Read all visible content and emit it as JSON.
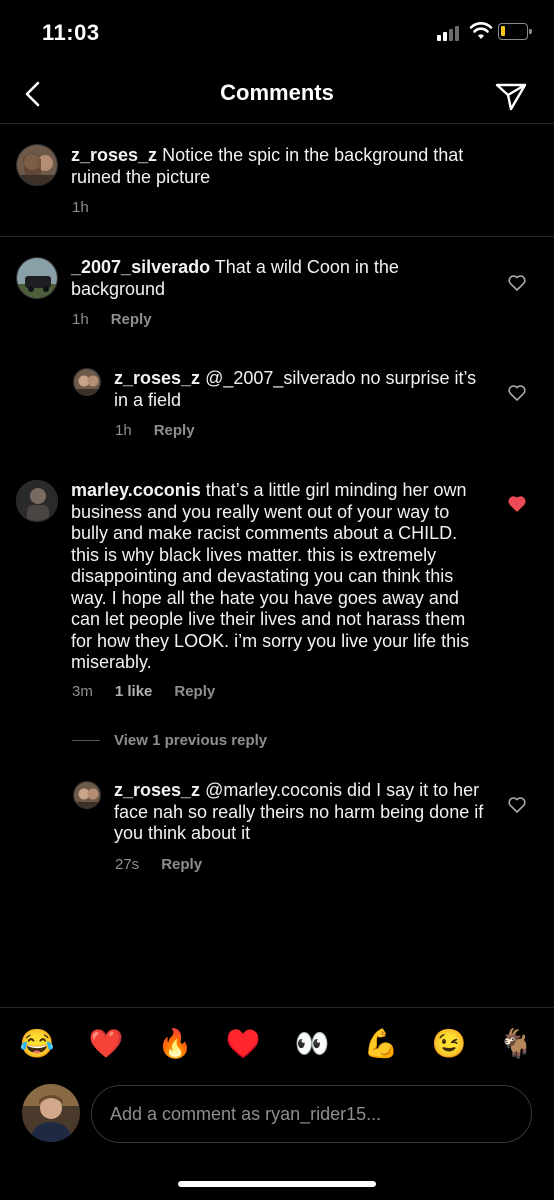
{
  "status_bar": {
    "time": "11:03"
  },
  "header": {
    "title": "Comments"
  },
  "caption": {
    "username": "z_roses_z",
    "text": "Notice the spic in the background that ruined the picture",
    "time": "1h"
  },
  "comments": [
    {
      "username": "_2007_silverado",
      "text": "That a wild Coon in the background",
      "time": "1h",
      "reply_label": "Reply",
      "liked": false
    },
    {
      "username": "z_roses_z",
      "text": "@_2007_silverado no surprise it’s in a field",
      "time": "1h",
      "reply_label": "Reply",
      "liked": false
    },
    {
      "username": "marley.coconis",
      "text": "that’s a little girl minding her own business and you really went out of your way to bully and make racist comments about a CHILD. this is why black lives matter. this is extremely disappointing and devastating you can think this way. I hope all the hate you have goes away and can let people live their lives and not harass them for how they LOOK. i’m sorry you live your life this miserably.",
      "time": "3m",
      "likes": "1 like",
      "reply_label": "Reply",
      "liked": true
    },
    {
      "username": "z_roses_z",
      "text": "@marley.coconis did I say it to her face nah so really theirs no harm being done if you think about it",
      "time": "27s",
      "reply_label": "Reply",
      "liked": false
    }
  ],
  "view_previous": "View 1 previous reply",
  "emojis": [
    "😂",
    "❤️",
    "🔥",
    "♥️",
    "👀",
    "💪",
    "😉",
    "🐐"
  ],
  "composer": {
    "placeholder": "Add a comment as ryan_rider15..."
  },
  "colors": {
    "liked_heart": "#ed4956",
    "muted_text": "#8e8e8e",
    "background": "#000000"
  }
}
